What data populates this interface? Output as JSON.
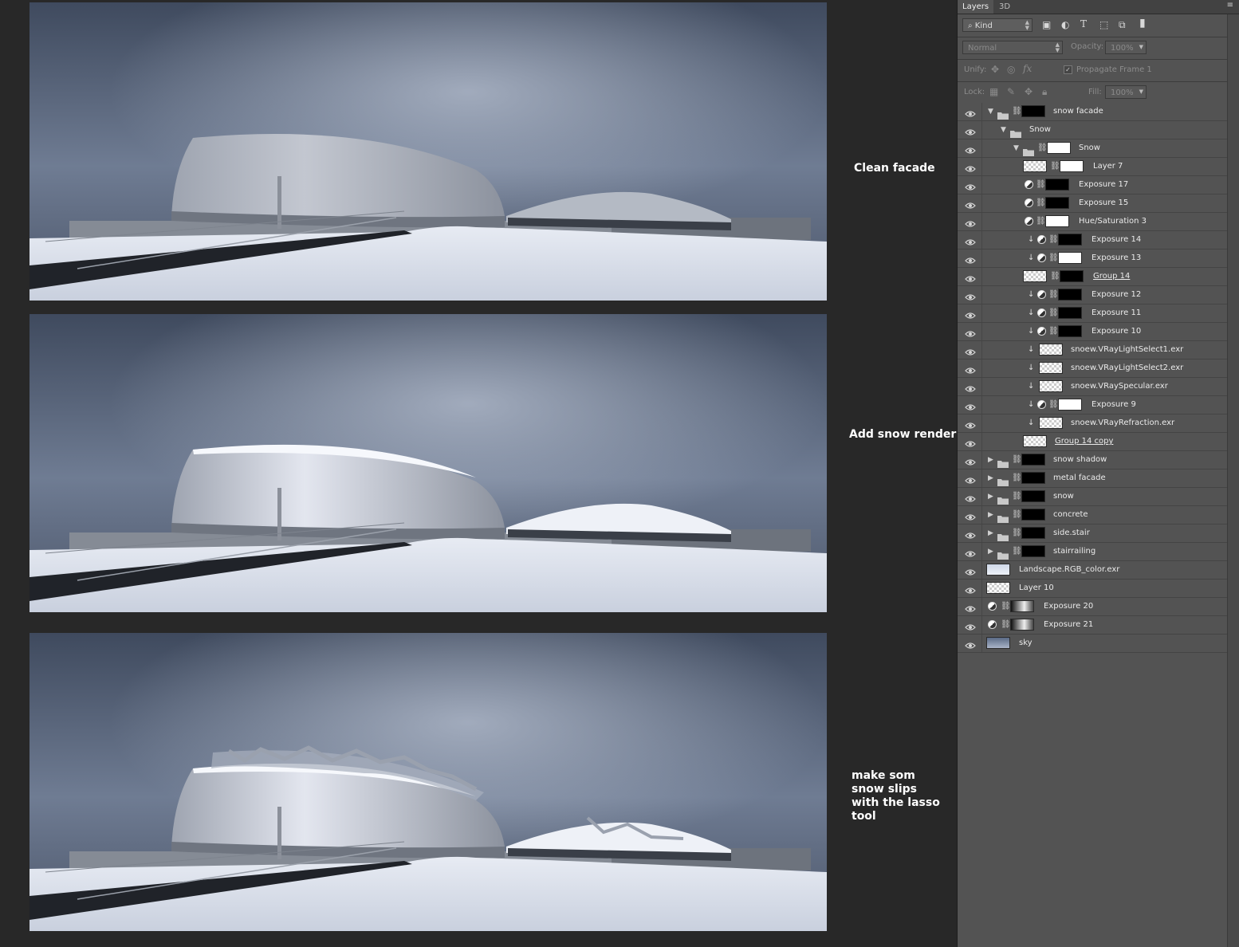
{
  "captions": [
    "Clean facade",
    "Add snow render",
    "make som\nsnow slips\nwith the lasso\ntool"
  ],
  "panel": {
    "tabs": [
      "Layers",
      "3D"
    ],
    "menu_icon": "panel-menu-icon",
    "filter_kind": "Kind",
    "blend_mode": "Normal",
    "opacity_label": "Opacity:",
    "opacity_value": "100%",
    "unify_label": "Unify:",
    "propagate_label": "Propagate Frame 1",
    "lock_label": "Lock:",
    "fill_label": "Fill:",
    "fill_value": "100%"
  },
  "layers": [
    {
      "name": "snow facade",
      "type": "group",
      "indent": 0,
      "expanded": true,
      "thumb": "black"
    },
    {
      "name": "Snow",
      "type": "group",
      "indent": 1,
      "expanded": true,
      "thumb": "none"
    },
    {
      "name": "Snow",
      "type": "group",
      "indent": 2,
      "expanded": true,
      "thumb": "white"
    },
    {
      "name": "Layer 7",
      "type": "pixel",
      "indent": 3,
      "thumb": "check",
      "mask": "white"
    },
    {
      "name": "Exposure 17",
      "type": "adjust",
      "indent": 3,
      "thumb": "black"
    },
    {
      "name": "Exposure 15",
      "type": "adjust",
      "indent": 3,
      "thumb": "black"
    },
    {
      "name": "Hue/Saturation 3",
      "type": "adjust",
      "indent": 3,
      "thumb": "white"
    },
    {
      "name": "Exposure 14",
      "type": "adjust",
      "indent": 3,
      "clip": true,
      "thumb": "black"
    },
    {
      "name": "Exposure 13",
      "type": "adjust",
      "indent": 3,
      "clip": true,
      "thumb": "white"
    },
    {
      "name": "Group 14",
      "type": "pixel",
      "indent": 3,
      "thumb": "check",
      "mask": "black",
      "underline": true
    },
    {
      "name": "Exposure 12",
      "type": "adjust",
      "indent": 3,
      "clip": true,
      "thumb": "black"
    },
    {
      "name": "Exposure 11",
      "type": "adjust",
      "indent": 3,
      "clip": true,
      "thumb": "black"
    },
    {
      "name": "Exposure 10",
      "type": "adjust",
      "indent": 3,
      "clip": true,
      "thumb": "black"
    },
    {
      "name": "snoew.VRayLightSelect1.exr",
      "type": "exr",
      "indent": 3,
      "clip": true,
      "thumb": "check"
    },
    {
      "name": "snoew.VRayLightSelect2.exr",
      "type": "exr",
      "indent": 3,
      "clip": true,
      "thumb": "check"
    },
    {
      "name": "snoew.VRaySpecular.exr",
      "type": "exr",
      "indent": 3,
      "clip": true,
      "thumb": "check"
    },
    {
      "name": "Exposure 9",
      "type": "adjust",
      "indent": 3,
      "clip": true,
      "thumb": "white"
    },
    {
      "name": "snoew.VRayRefraction.exr",
      "type": "exr",
      "indent": 3,
      "clip": true,
      "thumb": "check"
    },
    {
      "name": "Group 14 copy",
      "type": "pixel",
      "indent": 3,
      "thumb": "check",
      "underline": true
    },
    {
      "name": "snow shadow",
      "type": "group",
      "indent": 0,
      "expanded": false,
      "thumb": "black"
    },
    {
      "name": "metal facade",
      "type": "group",
      "indent": 0,
      "expanded": false,
      "thumb": "black"
    },
    {
      "name": "snow",
      "type": "group",
      "indent": 0,
      "expanded": false,
      "thumb": "black"
    },
    {
      "name": "concrete",
      "type": "group",
      "indent": 0,
      "expanded": false,
      "thumb": "black"
    },
    {
      "name": "side.stair",
      "type": "group",
      "indent": 0,
      "expanded": false,
      "thumb": "black"
    },
    {
      "name": "stairrailing",
      "type": "group",
      "indent": 0,
      "expanded": false,
      "thumb": "black"
    },
    {
      "name": "Landscape.RGB_color.exr",
      "type": "plain",
      "indent": 0,
      "thumb": "land"
    },
    {
      "name": "Layer 10",
      "type": "plain",
      "indent": 0,
      "thumb": "check"
    },
    {
      "name": "Exposure 20",
      "type": "adjust-top",
      "indent": 0,
      "thumb": "grad"
    },
    {
      "name": "Exposure 21",
      "type": "adjust-top",
      "indent": 0,
      "thumb": "grad"
    },
    {
      "name": "sky",
      "type": "plain",
      "indent": 0,
      "thumb": "sky"
    }
  ]
}
